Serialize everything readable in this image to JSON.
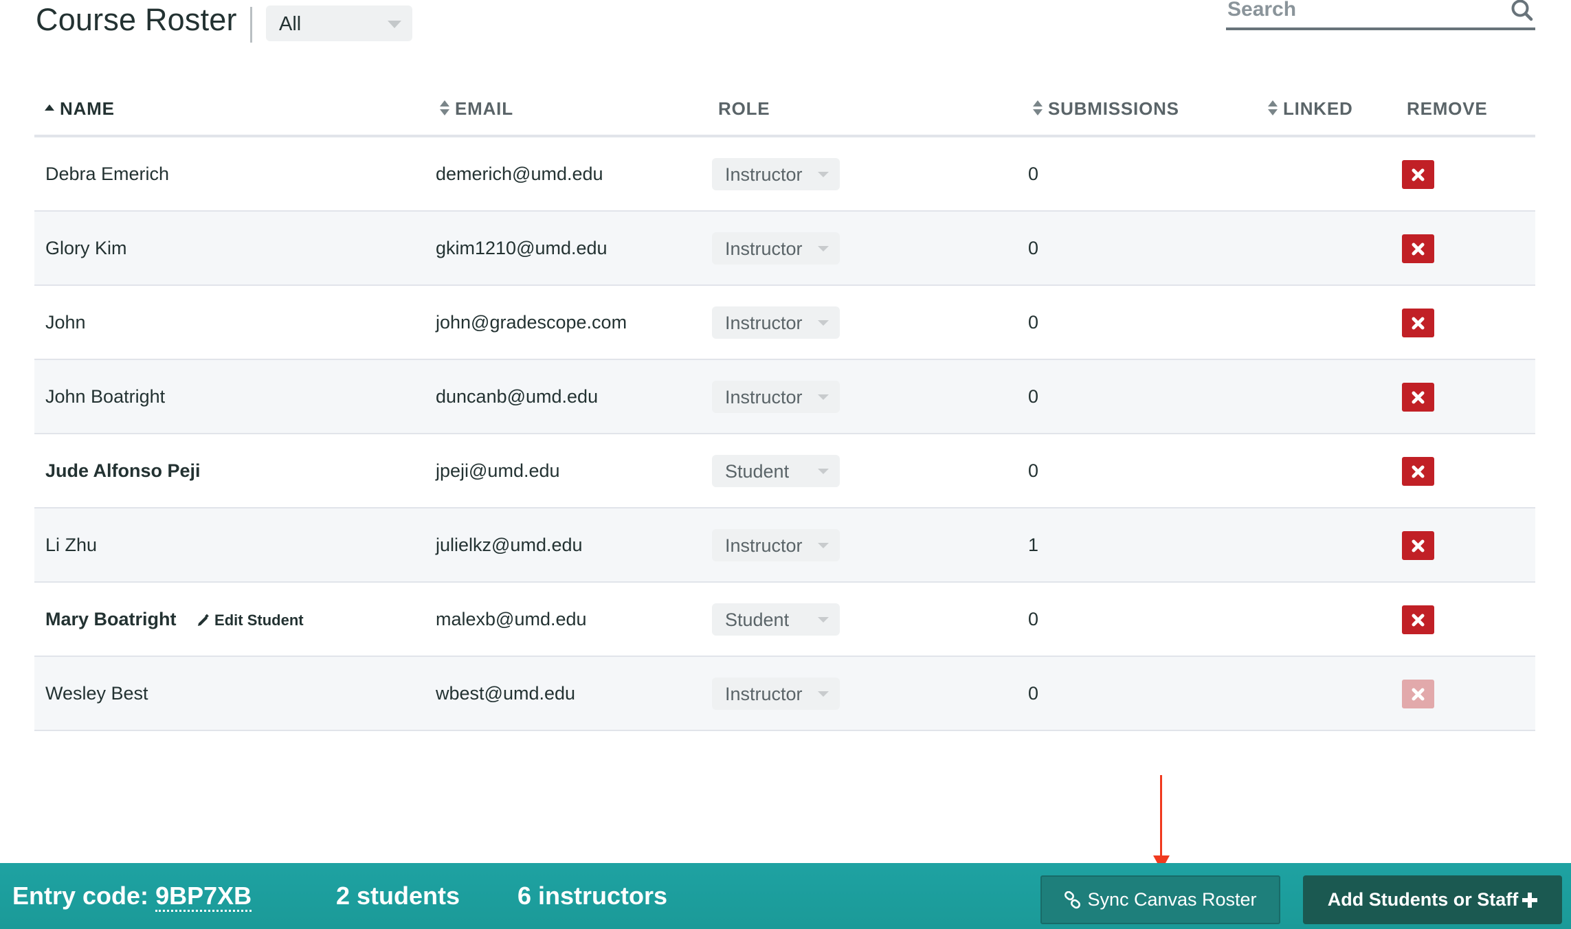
{
  "header": {
    "title": "Course Roster",
    "filter": {
      "selected": "All"
    },
    "search": {
      "placeholder": "Search",
      "value": "",
      "icon": "search-icon"
    }
  },
  "table": {
    "columns": [
      {
        "key": "name",
        "label": "NAME",
        "sort": "ascending"
      },
      {
        "key": "email",
        "label": "EMAIL",
        "sort": "sortable"
      },
      {
        "key": "role",
        "label": "ROLE",
        "sort": "none"
      },
      {
        "key": "submissions",
        "label": "SUBMISSIONS",
        "sort": "sortable"
      },
      {
        "key": "linked",
        "label": "LINKED",
        "sort": "sortable"
      },
      {
        "key": "remove",
        "label": "REMOVE",
        "sort": "none"
      }
    ],
    "rows": [
      {
        "name": "Debra Emerich",
        "bold": false,
        "email": "demerich@umd.edu",
        "role": "Instructor",
        "submissions": "0",
        "linked": "",
        "remove_enabled": true
      },
      {
        "name": "Glory Kim",
        "bold": false,
        "email": "gkim1210@umd.edu",
        "role": "Instructor",
        "submissions": "0",
        "linked": "",
        "remove_enabled": true
      },
      {
        "name": "John",
        "bold": false,
        "email": "john@gradescope.com",
        "role": "Instructor",
        "submissions": "0",
        "linked": "",
        "remove_enabled": true
      },
      {
        "name": "John Boatright",
        "bold": false,
        "email": "duncanb@umd.edu",
        "role": "Instructor",
        "submissions": "0",
        "linked": "",
        "remove_enabled": true
      },
      {
        "name": "Jude Alfonso Peji",
        "bold": true,
        "email": "jpeji@umd.edu",
        "role": "Student",
        "submissions": "0",
        "linked": "",
        "remove_enabled": true
      },
      {
        "name": "Li Zhu",
        "bold": false,
        "email": "julielkz@umd.edu",
        "role": "Instructor",
        "submissions": "1",
        "linked": "",
        "remove_enabled": true
      },
      {
        "name": "Mary Boatright",
        "bold": true,
        "edit_label": "Edit Student",
        "email": "malexb@umd.edu",
        "role": "Student",
        "submissions": "0",
        "linked": "",
        "remove_enabled": true
      },
      {
        "name": "Wesley Best",
        "bold": false,
        "email": "wbest@umd.edu",
        "role": "Instructor",
        "submissions": "0",
        "linked": "",
        "remove_enabled": false
      }
    ]
  },
  "footer": {
    "entry_code_label": "Entry code:",
    "entry_code": "9BP7XB",
    "students_count": "2 students",
    "instructors_count": "6 instructors",
    "sync_button": "Sync Canvas Roster",
    "add_button": "Add Students or Staff"
  },
  "colors": {
    "footer_bg": "#1ea2a2",
    "sync_button_bg": "#1e7f7b",
    "add_button_bg": "#1b5951",
    "remove_button": "#c12026",
    "remove_button_disabled": "#e2a9ab",
    "annotation_arrow": "#f03a1f"
  }
}
